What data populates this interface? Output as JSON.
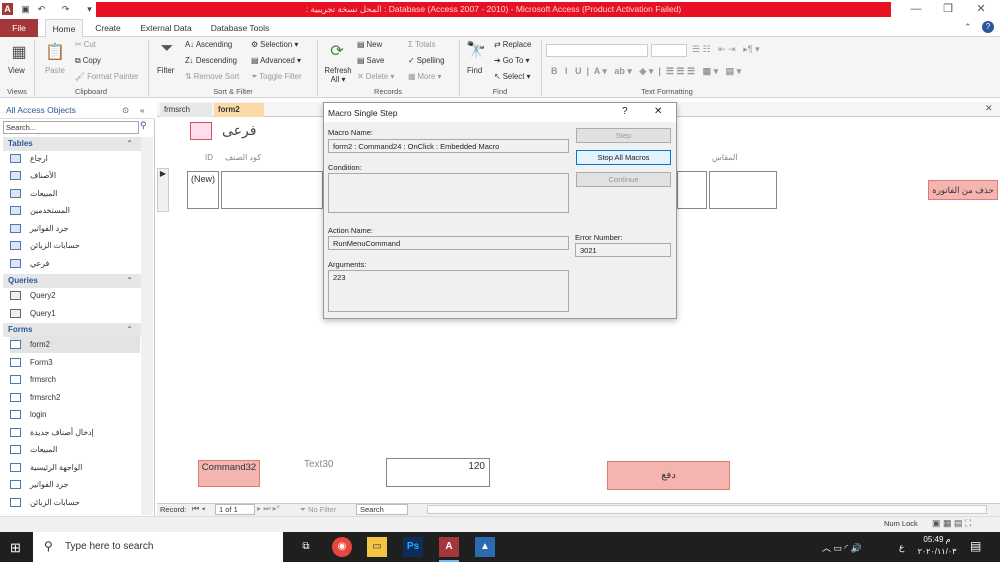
{
  "window": {
    "title": ": المحل نسخة تجريبية : Database (Access 2007 - 2010) - Microsoft Access (Product Activation Failed)",
    "minimize": "—",
    "restore": "❐",
    "close": "✕"
  },
  "ribbon_tabs": {
    "file": "File",
    "home": "Home",
    "create": "Create",
    "external": "External Data",
    "dbtools": "Database Tools"
  },
  "ribbon": {
    "view": "View",
    "paste": "Paste",
    "cut": "Cut",
    "copy": "Copy",
    "format_painter": "Format Painter",
    "filter": "Filter",
    "ascending": "Ascending",
    "descending": "Descending",
    "remove_sort": "Remove Sort",
    "selection": "Selection ▾",
    "advanced": "Advanced ▾",
    "toggle_filter": "Toggle Filter",
    "refresh": "Refresh All ▾",
    "new": "New",
    "save": "Save",
    "delete": "Delete ▾",
    "totals": "Totals",
    "spelling": "Spelling",
    "more": "More ▾",
    "find": "Find",
    "replace": "Replace",
    "goto": "Go To ▾",
    "select": "Select ▾",
    "groups": {
      "views": "Views",
      "clipboard": "Clipboard",
      "sortfilter": "Sort & Filter",
      "records": "Records",
      "find": "Find",
      "textformat": "Text Formatting"
    }
  },
  "nav": {
    "header": "All Access Objects",
    "search_placeholder": "Search...",
    "tables_label": "Tables",
    "tables": [
      "ارجاع",
      "الأصناف",
      "المبيعات",
      "المستخدمين",
      "جرد الفواتير",
      "حسابات الزبائن",
      "فرعي"
    ],
    "queries_label": "Queries",
    "queries": [
      "Query2",
      "Query1"
    ],
    "forms_label": "Forms",
    "forms": [
      "form2",
      "Form3",
      "frmsrch",
      "frmsrch2",
      "login",
      "إدخال أصناف جديدة",
      "المبيعات",
      "الواجهة الرئيسية",
      "جرد الفواتير",
      "حسابات الزبائن"
    ]
  },
  "doc_tabs": {
    "tab1": "frmsrch",
    "tab2": "form2"
  },
  "form": {
    "title": "فرعى",
    "col_id": "ID",
    "col_code": "كود الصنف",
    "col_size": "المقاس",
    "new_cell": "(New)",
    "delete_btn": "حذف من الفاتورة",
    "command_btn": "Command32",
    "text_label": "Text30",
    "text_value": "120",
    "pay_btn": "دفع"
  },
  "record_nav": {
    "label": "Record:",
    "current": "1 of 1",
    "nofilter": "No Filter",
    "search": "Search"
  },
  "status": {
    "numlock": "Num Lock"
  },
  "dialog": {
    "title": "Macro Single Step",
    "help": "?",
    "close": "✕",
    "macro_name_label": "Macro Name:",
    "macro_name": "form2 : Command24 : OnClick : Embedded Macro",
    "condition_label": "Condition:",
    "action_name_label": "Action Name:",
    "action_name": "RunMenuCommand",
    "arguments_label": "Arguments:",
    "arguments": "223",
    "error_number_label": "Error Number:",
    "error_number": "3021",
    "step_btn": "Step",
    "stop_btn": "Stop All Macros",
    "continue_btn": "Continue"
  },
  "taskbar": {
    "search_placeholder": "Type here to search",
    "time": "05:49 م",
    "date": "٢٠٢٠/١١/٠٣",
    "lang": "ع"
  }
}
